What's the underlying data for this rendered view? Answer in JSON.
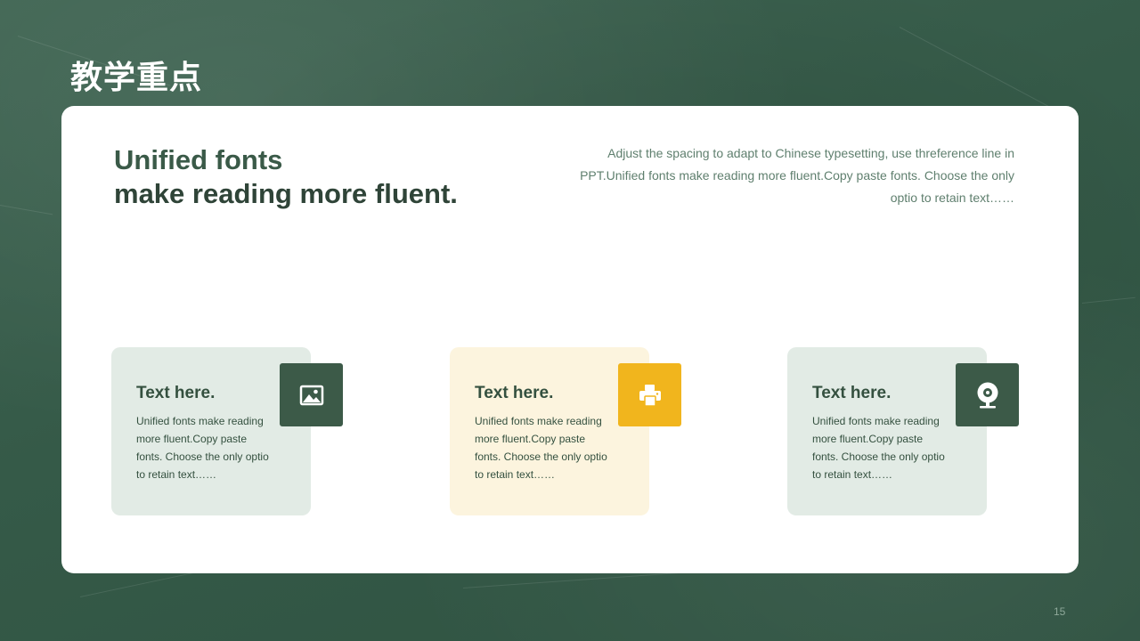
{
  "page_title": "教学重点",
  "headline": {
    "line1": "Unified fonts",
    "line2": "make reading more fluent."
  },
  "intro": "Adjust the spacing to adapt to Chinese typesetting, use threference line in PPT.Unified fonts make reading more fluent.Copy paste fonts. Choose the only optio to retain text……",
  "cards": [
    {
      "title": "Text here.",
      "body": "Unified fonts make reading more fluent.Copy paste fonts. Choose the only optio to retain text……",
      "icon": "image-icon",
      "accent": "#3c5a48",
      "background": "#e2ebe5"
    },
    {
      "title": "Text here.",
      "body": "Unified fonts make reading more fluent.Copy paste fonts. Choose the only optio to retain text……",
      "icon": "printer-icon",
      "accent": "#f1b51d",
      "background": "#fcf4de"
    },
    {
      "title": "Text here.",
      "body": "Unified fonts make reading more fluent.Copy paste fonts. Choose the only optio to retain text……",
      "icon": "webcam-icon",
      "accent": "#3c5a48",
      "background": "#e2ebe5"
    }
  ],
  "page_number": "15",
  "colors": {
    "chalkboard": "#355a48",
    "dark_green": "#3c5a48",
    "yellow": "#f1b51d"
  }
}
